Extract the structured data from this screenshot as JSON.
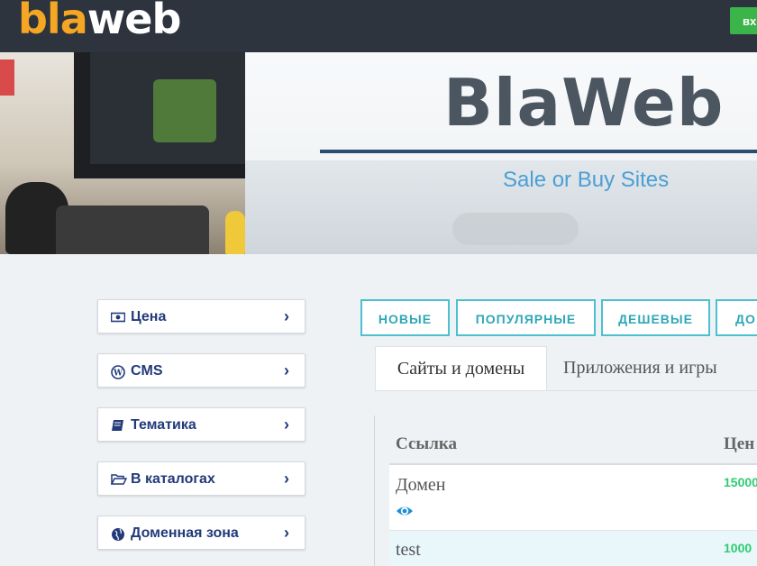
{
  "header": {
    "logo_part1": "bla",
    "logo_part2": "web",
    "login_label": "вх"
  },
  "hero": {
    "title": "BlaWeb",
    "subtitle": "Sale or Buy Sites"
  },
  "sidebar": {
    "items": [
      {
        "label": "Цена",
        "icon": "money-icon"
      },
      {
        "label": "CMS",
        "icon": "wordpress-icon"
      },
      {
        "label": "Тематика",
        "icon": "book-icon"
      },
      {
        "label": "В каталогах",
        "icon": "folder-open-icon"
      },
      {
        "label": "Доменная зона",
        "icon": "globe-icon"
      }
    ]
  },
  "filters": [
    "НОВЫЕ",
    "ПОПУЛЯРНЫЕ",
    "ДЕШЕВЫЕ",
    "ДО"
  ],
  "tabs": [
    {
      "label": "Сайты и домены",
      "active": true
    },
    {
      "label": "Приложения и игры",
      "active": false
    }
  ],
  "table": {
    "columns": [
      "Ссылка",
      "Цен"
    ],
    "rows": [
      {
        "link": "Домен",
        "price": "15000"
      },
      {
        "link": "test",
        "price": "1000"
      }
    ]
  },
  "colors": {
    "topbar": "#2d343e",
    "logo_accent": "#f5a623",
    "login_green": "#3bb54a",
    "sidebar_text": "#223a7a",
    "filter_teal": "#4cc0cf",
    "price_green": "#2ecc71",
    "subtitle_blue": "#4a9fd5"
  }
}
